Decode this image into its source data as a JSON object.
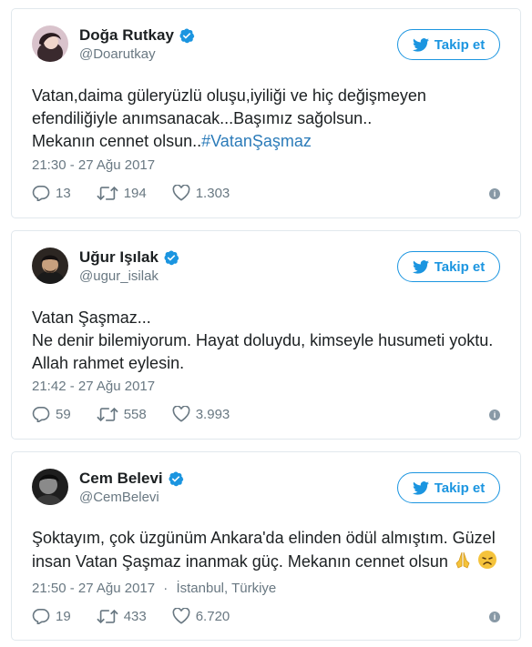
{
  "tweets": [
    {
      "name": "Doğa Rutkay",
      "handle": "@Doarutkay",
      "follow_label": "Takip et",
      "text_line1": "Vatan,daima güleryüzlü oluşu,iyiliği ve hiç değişmeyen",
      "text_line2": "efendiliğiyle anımsanacak...Başımız sağolsun..",
      "text_line3": "Mekanın cennet olsun..",
      "hashtag": "#VatanŞaşmaz",
      "timestamp": "21:30 - 27 Ağu 2017",
      "replies": "13",
      "retweets": "194",
      "likes": "1.303"
    },
    {
      "name": "Uğur Işılak",
      "handle": "@ugur_isilak",
      "follow_label": "Takip et",
      "text_line1": "Vatan Şaşmaz...",
      "text_line2": "Ne denir bilemiyorum. Hayat doluydu, kimseyle husumeti yoktu.",
      "text_line3": "Allah rahmet eylesin.",
      "timestamp": "21:42 - 27 Ağu 2017",
      "replies": "59",
      "retweets": "558",
      "likes": "3.993"
    },
    {
      "name": "Cem Belevi",
      "handle": "@CemBelevi",
      "follow_label": "Takip et",
      "text_line1": "Şoktayım, çok üzgünüm Ankara'da elinden ödül almıştım. Güzel",
      "text_line2": "insan Vatan Şaşmaz inanmak güç. Mekanın cennet olsun",
      "timestamp": "21:50 - 27 Ağu 2017",
      "separator": "·",
      "location": "İstanbul, Türkiye",
      "replies": "19",
      "retweets": "433",
      "likes": "6.720"
    }
  ],
  "icons": {
    "verified": "verified-badge-icon",
    "bird": "twitter-bird-icon",
    "reply": "reply-icon",
    "retweet": "retweet-icon",
    "like": "heart-icon",
    "info": "info-icon"
  },
  "colors": {
    "accent": "#1b95e0",
    "hashtag": "#2b7bb9",
    "muted": "#697882",
    "border": "#e1e8ed"
  }
}
